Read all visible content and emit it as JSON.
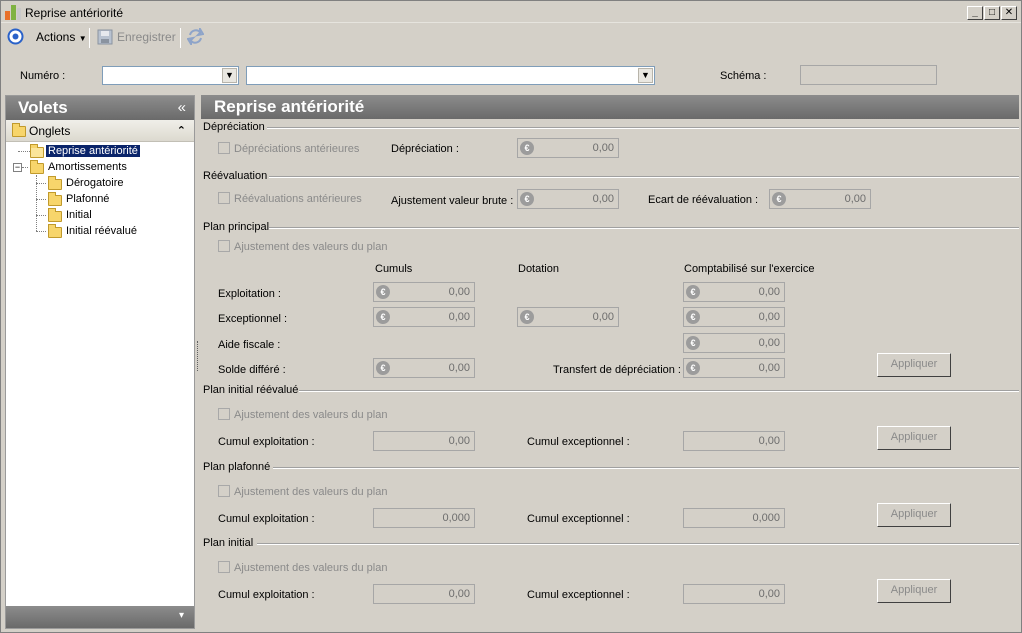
{
  "window": {
    "title": "Reprise antériorité",
    "controls": {
      "minimize": "_",
      "maximize": "□",
      "close": "✕"
    }
  },
  "toolbar": {
    "actions_label": "Actions",
    "save_label": "Enregistrer"
  },
  "header_fields": {
    "numero_label": "Numéro :",
    "numero_value": "",
    "numero_desc_value": "",
    "schema_label": "Schéma :",
    "schema_value": ""
  },
  "volets": {
    "title": "Volets",
    "collapse_glyph": "«",
    "onglets_label": "Onglets",
    "onglets_toggle": "⌃",
    "tree": {
      "reprise": "Reprise antériorité",
      "amortissements": "Amortissements",
      "expander": "−",
      "children": [
        "Dérogatoire",
        "Plafonné",
        "Initial",
        "Initial réévalué"
      ]
    },
    "footer_glyph": "▾"
  },
  "main": {
    "title": "Reprise antériorité",
    "currency_symbol": "€",
    "apply_label": "Appliquer",
    "depreciation": {
      "section": "Dépréciation",
      "checkbox": "Dépréciations antérieures",
      "field_label": "Dépréciation :",
      "field_value": "0,00"
    },
    "reevaluation": {
      "section": "Réévaluation",
      "checkbox": "Réévaluations antérieures",
      "adjust_label": "Ajustement valeur brute :",
      "adjust_value": "0,00",
      "ecart_label": "Ecart de réévaluation :",
      "ecart_value": "0,00"
    },
    "plan_principal": {
      "section": "Plan principal",
      "checkbox": "Ajustement des valeurs du plan",
      "col_cumuls": "Cumuls",
      "col_dotation": "Dotation",
      "col_comptabilise": "Comptabilisé sur l'exercice",
      "exploitation_label": "Exploitation :",
      "exploitation_cumul": "0,00",
      "exploitation_compta": "0,00",
      "exceptionnel_label": "Exceptionnel :",
      "exceptionnel_cumul": "0,00",
      "exceptionnel_dotation": "0,00",
      "exceptionnel_compta": "0,00",
      "aide_label": "Aide fiscale :",
      "aide_compta": "0,00",
      "solde_label": "Solde différé :",
      "solde_cumul": "0,00",
      "transfert_label": "Transfert de dépréciation :",
      "transfert_value": "0,00"
    },
    "plan_initial_reevalue": {
      "section": "Plan initial réévalué",
      "checkbox": "Ajustement des valeurs du plan",
      "cumul_exploit_label": "Cumul exploitation :",
      "cumul_exploit_value": "0,00",
      "cumul_except_label": "Cumul exceptionnel :",
      "cumul_except_value": "0,00"
    },
    "plan_plafonne": {
      "section": "Plan plafonné",
      "checkbox": "Ajustement des valeurs du plan",
      "cumul_exploit_label": "Cumul exploitation :",
      "cumul_exploit_value": "0,000",
      "cumul_except_label": "Cumul exceptionnel :",
      "cumul_except_value": "0,000"
    },
    "plan_initial": {
      "section": "Plan initial",
      "checkbox": "Ajustement des valeurs du plan",
      "cumul_exploit_label": "Cumul exploitation :",
      "cumul_exploit_value": "0,00",
      "cumul_except_label": "Cumul exceptionnel :",
      "cumul_except_value": "0,00"
    }
  }
}
